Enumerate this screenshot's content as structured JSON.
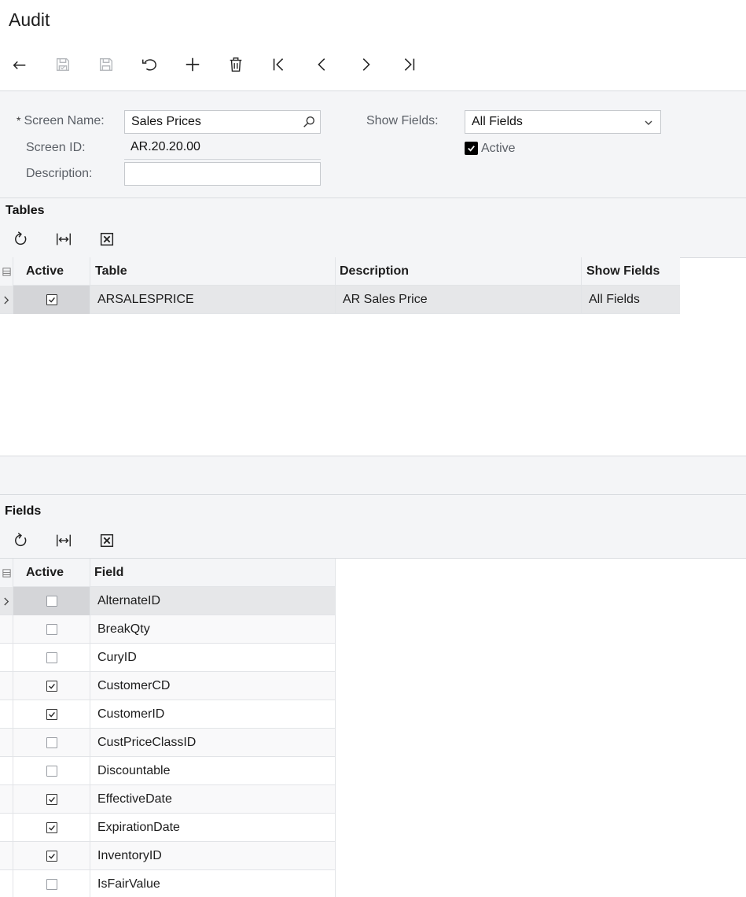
{
  "page": {
    "title": "Audit"
  },
  "toolbar": {
    "buttons": [
      {
        "icon": "undo-arrow-icon",
        "name": "back-button"
      },
      {
        "icon": "save-close-icon",
        "name": "save-close-button"
      },
      {
        "icon": "save-icon",
        "name": "save-button"
      },
      {
        "icon": "cancel-icon",
        "name": "cancel-button"
      },
      {
        "icon": "plus-icon",
        "name": "add-button"
      },
      {
        "icon": "trash-icon",
        "name": "delete-button"
      },
      {
        "icon": "first-icon",
        "name": "first-record-button"
      },
      {
        "icon": "prev-icon",
        "name": "previous-record-button"
      },
      {
        "icon": "next-icon",
        "name": "next-record-button"
      },
      {
        "icon": "last-icon",
        "name": "last-record-button"
      }
    ]
  },
  "form": {
    "screen_name_label": "Screen Name:",
    "screen_name_required": "*",
    "screen_name_value": "Sales Prices",
    "screen_id_label": "Screen ID:",
    "screen_id_value": "AR.20.20.00",
    "description_label": "Description:",
    "description_value": "",
    "show_fields_label": "Show Fields:",
    "show_fields_value": "All Fields",
    "active_label": "Active",
    "active_checked": true
  },
  "tables": {
    "title": "Tables",
    "columns": [
      "Active",
      "Table",
      "Description",
      "Show Fields"
    ],
    "rows": [
      {
        "active": true,
        "table": "ARSALESPRICE",
        "description": "AR Sales Price",
        "show_fields": "All Fields"
      }
    ]
  },
  "fields": {
    "title": "Fields",
    "columns": [
      "Active",
      "Field"
    ],
    "rows": [
      {
        "active": false,
        "field": "AlternateID"
      },
      {
        "active": false,
        "field": "BreakQty"
      },
      {
        "active": false,
        "field": "CuryID"
      },
      {
        "active": true,
        "field": "CustomerCD"
      },
      {
        "active": true,
        "field": "CustomerID"
      },
      {
        "active": false,
        "field": "CustPriceClassID"
      },
      {
        "active": false,
        "field": "Discountable"
      },
      {
        "active": true,
        "field": "EffectiveDate"
      },
      {
        "active": true,
        "field": "ExpirationDate"
      },
      {
        "active": true,
        "field": "InventoryID"
      },
      {
        "active": false,
        "field": "IsFairValue"
      }
    ]
  }
}
